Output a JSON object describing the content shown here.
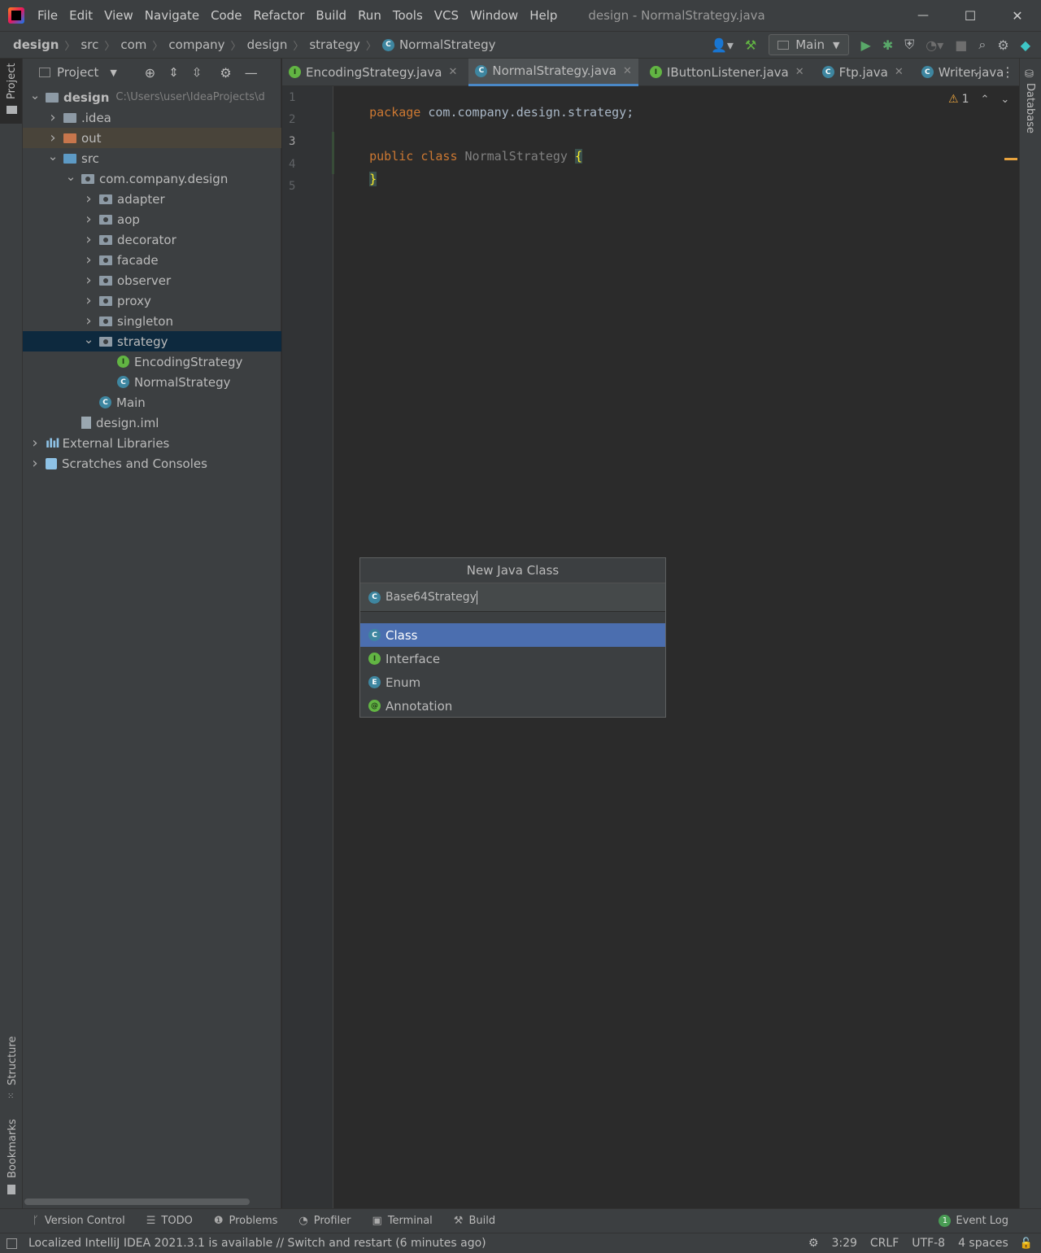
{
  "window": {
    "title": "design - NormalStrategy.java",
    "minimize": "—",
    "maximize": "☐",
    "close": "✕"
  },
  "menu": [
    "File",
    "Edit",
    "View",
    "Navigate",
    "Code",
    "Refactor",
    "Build",
    "Run",
    "Tools",
    "VCS",
    "Window",
    "Help"
  ],
  "breadcrumb": [
    "design",
    "src",
    "com",
    "company",
    "design",
    "strategy",
    "NormalStrategy"
  ],
  "toolbar": {
    "run_config": "Main"
  },
  "project_panel": {
    "title": "Project",
    "tree": [
      {
        "label": "design",
        "extra": "C:\\Users\\user\\IdeaProjects\\d",
        "level": 0,
        "expanded": true,
        "icon": "module-folder"
      },
      {
        "label": ".idea",
        "level": 1,
        "expanded": false,
        "icon": "folder"
      },
      {
        "label": "out",
        "level": 1,
        "expanded": false,
        "icon": "folder-orange"
      },
      {
        "label": "src",
        "level": 1,
        "expanded": true,
        "icon": "folder-blue"
      },
      {
        "label": "com.company.design",
        "level": 2,
        "expanded": true,
        "icon": "package"
      },
      {
        "label": "adapter",
        "level": 3,
        "expanded": false,
        "icon": "package"
      },
      {
        "label": "aop",
        "level": 3,
        "expanded": false,
        "icon": "package"
      },
      {
        "label": "decorator",
        "level": 3,
        "expanded": false,
        "icon": "package"
      },
      {
        "label": "facade",
        "level": 3,
        "expanded": false,
        "icon": "package"
      },
      {
        "label": "observer",
        "level": 3,
        "expanded": false,
        "icon": "package"
      },
      {
        "label": "proxy",
        "level": 3,
        "expanded": false,
        "icon": "package"
      },
      {
        "label": "singleton",
        "level": 3,
        "expanded": false,
        "icon": "package"
      },
      {
        "label": "strategy",
        "level": 3,
        "expanded": true,
        "icon": "package",
        "selected": true
      },
      {
        "label": "EncodingStrategy",
        "level": 4,
        "icon": "interface"
      },
      {
        "label": "NormalStrategy",
        "level": 4,
        "icon": "class"
      },
      {
        "label": "Main",
        "level": 3,
        "icon": "class-main"
      },
      {
        "label": "design.iml",
        "level": 2,
        "icon": "file"
      },
      {
        "label": "External Libraries",
        "level": 0,
        "expanded": false,
        "icon": "libraries"
      },
      {
        "label": "Scratches and Consoles",
        "level": 0,
        "expanded": false,
        "icon": "scratches"
      }
    ]
  },
  "tabs": [
    {
      "label": "EncodingStrategy.java",
      "icon": "interface",
      "active": false
    },
    {
      "label": "NormalStrategy.java",
      "icon": "class",
      "active": true
    },
    {
      "label": "IButtonListener.java",
      "icon": "interface",
      "active": false
    },
    {
      "label": "Ftp.java",
      "icon": "class",
      "active": false
    },
    {
      "label": "Writer.java",
      "icon": "class",
      "active": false
    }
  ],
  "editor": {
    "line_numbers": [
      "1",
      "2",
      "3",
      "4",
      "5"
    ],
    "current_line": 3,
    "warnings": "1",
    "lines": [
      {
        "kw": "package",
        "rest": " com.company.design.strategy;"
      },
      {},
      {
        "kw": "public class",
        "name": " NormalStrategy ",
        "brace": "{"
      },
      {
        "brace": "}"
      },
      {}
    ]
  },
  "dialog": {
    "title": "New Java Class",
    "input_value": "Base64Strategy",
    "options": [
      {
        "label": "Class",
        "icon": "C",
        "selected": true
      },
      {
        "label": "Interface",
        "icon": "I",
        "selected": false
      },
      {
        "label": "Enum",
        "icon": "E",
        "selected": false
      },
      {
        "label": "Annotation",
        "icon": "@",
        "selected": false
      }
    ]
  },
  "side_tabs": {
    "left_top": "Project",
    "left_structure": "Structure",
    "left_bookmarks": "Bookmarks",
    "right": "Database"
  },
  "bottom_tools": [
    "Version Control",
    "TODO",
    "Problems",
    "Profiler",
    "Terminal",
    "Build"
  ],
  "event_log": {
    "count": "1",
    "label": "Event Log"
  },
  "status": {
    "message": "Localized IntelliJ IDEA 2021.3.1 is available // Switch and restart (6 minutes ago)",
    "position": "3:29",
    "line_sep": "CRLF",
    "encoding": "UTF-8",
    "indent": "4 spaces"
  }
}
